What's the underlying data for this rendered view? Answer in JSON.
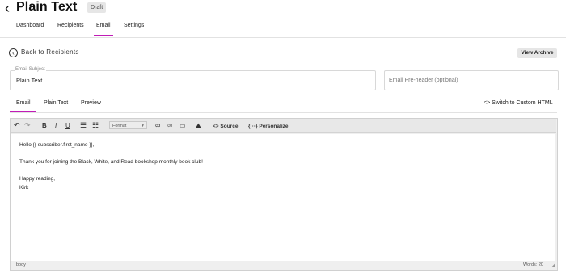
{
  "header": {
    "title": "Plain Text",
    "badge": "Draft",
    "back_glyph": "‹"
  },
  "top_tabs": [
    {
      "label": "Dashboard",
      "active": false
    },
    {
      "label": "Recipients",
      "active": false
    },
    {
      "label": "Email",
      "active": true
    },
    {
      "label": "Settings",
      "active": false
    }
  ],
  "back_link": {
    "label": "Back to Recipients",
    "icon": "arrow-left-circle-icon"
  },
  "view_archive": "View Archive",
  "subject": {
    "legend": "Email Subject",
    "value": "Plain Text"
  },
  "preheader": {
    "placeholder": "Email Pre-header (optional)"
  },
  "editor_tabs": [
    {
      "label": "Email",
      "active": true
    },
    {
      "label": "Plain Text",
      "active": false
    },
    {
      "label": "Preview",
      "active": false
    }
  ],
  "switch_html": "Switch to Custom HTML",
  "toolbar": {
    "format": "Format",
    "source": "Source",
    "personalize": "Personalize"
  },
  "body_lines": [
    "Hello {{ subscriber.first_name }},",
    "Thank you for joining the Black, White, and Read bookshop monthly book club!",
    "Happy reading,",
    "Kirk"
  ],
  "status": {
    "path": "body",
    "words": "Words: 20"
  },
  "colors": {
    "accent": "#c01cb6",
    "toolbar_bg": "#e8e8e8"
  }
}
